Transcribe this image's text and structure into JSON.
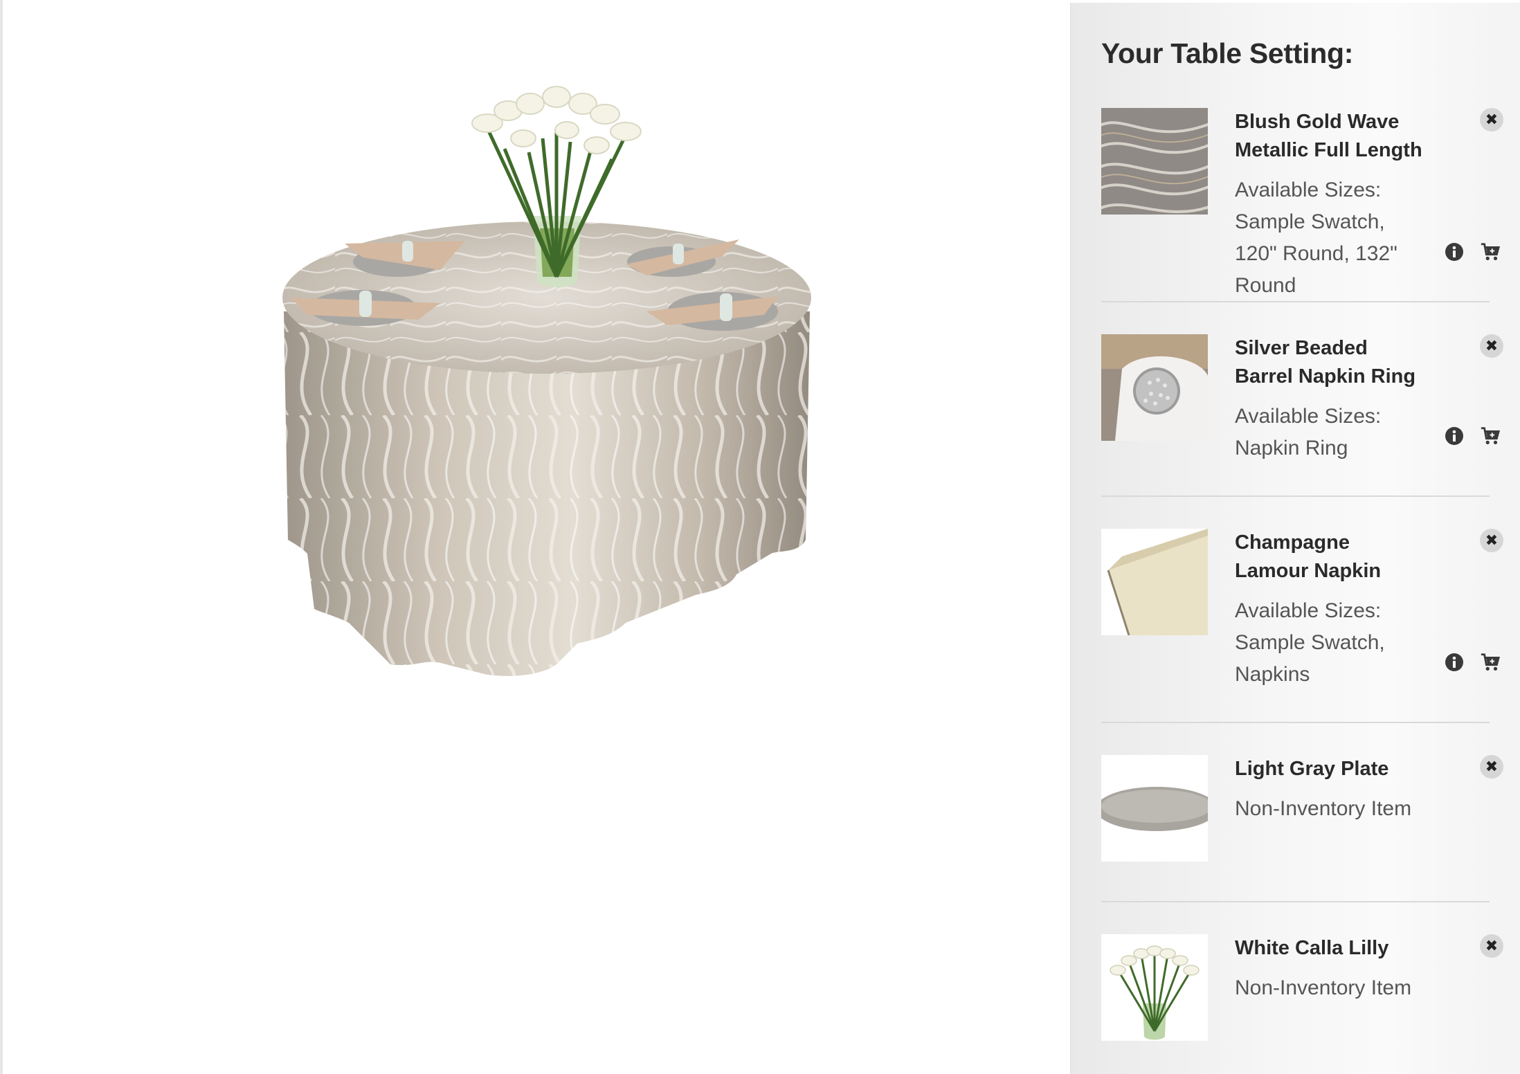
{
  "panel": {
    "title": "Your Table Setting:"
  },
  "items": [
    {
      "name": "Blush Gold Wave Metallic Full Length",
      "sizes_label": "Available Sizes:",
      "sizes": "Sample Swatch, 120\" Round, 132\" Round",
      "thumb_icon": "fabric-swatch",
      "actions": [
        "info-icon",
        "add-to-cart-icon"
      ]
    },
    {
      "name": "Silver Beaded Barrel Napkin Ring",
      "sizes_label": "Available Sizes:",
      "sizes": "Napkin Ring",
      "thumb_icon": "napkin-ring",
      "actions": [
        "info-icon",
        "add-to-cart-icon"
      ]
    },
    {
      "name": "Champagne Lamour Napkin",
      "sizes_label": "Available Sizes:",
      "sizes": "Sample Swatch, Napkins",
      "thumb_icon": "folded-napkin",
      "actions": [
        "info-icon",
        "add-to-cart-icon"
      ]
    },
    {
      "name": "Light Gray Plate",
      "note": "Non-Inventory Item",
      "thumb_icon": "plate"
    },
    {
      "name": "White Calla Lilly",
      "note": "Non-Inventory Item",
      "thumb_icon": "calla-lily-vase"
    }
  ],
  "icons": {
    "remove": "✖",
    "info": "info-circle",
    "cart": "cart-plus"
  },
  "colors": {
    "panel_bg": "#f3f3f3",
    "text_dark": "#2a2a2a",
    "text_muted": "#555555",
    "divider": "#d9d9d9",
    "tablecloth": "#b9b0a4"
  }
}
